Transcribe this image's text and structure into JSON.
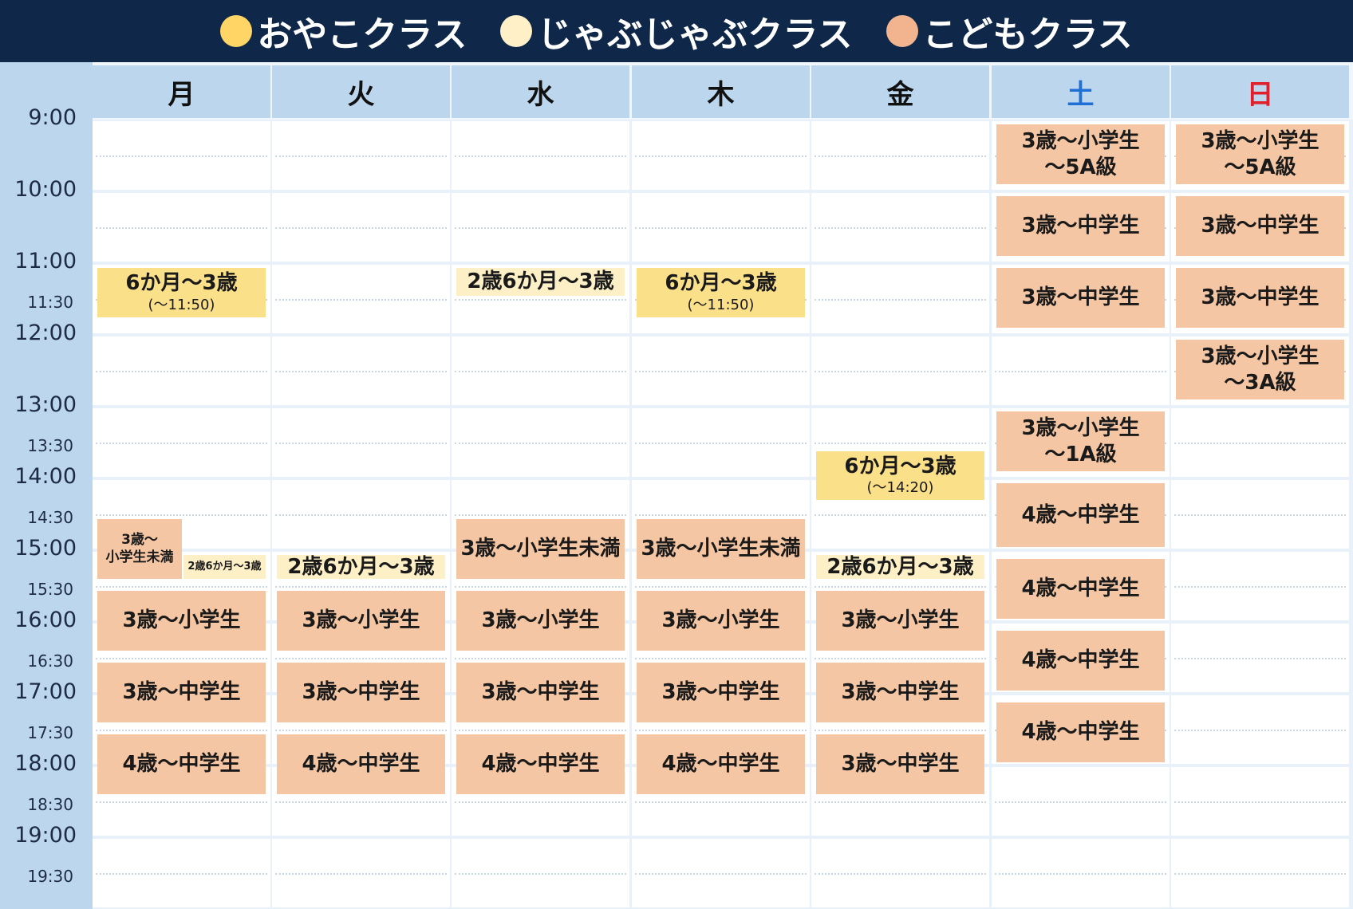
{
  "legend": [
    {
      "label": "おやこクラス",
      "color": "#ffd666"
    },
    {
      "label": "じゃぶじゃぶクラス",
      "color": "#fff0c7"
    },
    {
      "label": "こどもクラス",
      "color": "#f2b48f"
    }
  ],
  "days": [
    {
      "label": "月",
      "color": "#111111"
    },
    {
      "label": "火",
      "color": "#111111"
    },
    {
      "label": "水",
      "color": "#111111"
    },
    {
      "label": "木",
      "color": "#111111"
    },
    {
      "label": "金",
      "color": "#111111"
    },
    {
      "label": "土",
      "color": "#1f6fd6"
    },
    {
      "label": "日",
      "color": "#e0202a"
    }
  ],
  "times": [
    "9:00",
    "10:00",
    "11:00",
    "11:30",
    "12:00",
    "13:00",
    "13:30",
    "14:00",
    "14:30",
    "15:00",
    "15:30",
    "16:00",
    "16:30",
    "17:00",
    "17:30",
    "18:00",
    "18:30",
    "19:00",
    "19:30"
  ],
  "class_colors": {
    "kodomo": "#f5c6a3",
    "oyako": "#fbe08a",
    "jabu": "#fdefc6"
  },
  "events": [
    {
      "day": 0,
      "start": 11.0,
      "end": 11.75,
      "type": "oyako",
      "text": "6か月～3歳",
      "sub": "(～11:50)"
    },
    {
      "day": 0,
      "start": 14.5,
      "end": 15.4,
      "type": "kodomo",
      "text": "3歳～\n小学生未満",
      "part": "left",
      "small": true
    },
    {
      "day": 0,
      "start": 15.0,
      "end": 15.4,
      "type": "jabu",
      "text": "2歳6か月～3歳",
      "part": "right",
      "tiny": true
    },
    {
      "day": 0,
      "start": 15.5,
      "end": 16.4,
      "type": "kodomo",
      "text": "3歳～小学生"
    },
    {
      "day": 0,
      "start": 16.5,
      "end": 17.4,
      "type": "kodomo",
      "text": "3歳～中学生"
    },
    {
      "day": 0,
      "start": 17.5,
      "end": 18.4,
      "type": "kodomo",
      "text": "4歳～中学生"
    },
    {
      "day": 1,
      "start": 15.0,
      "end": 15.4,
      "type": "jabu",
      "text": "2歳6か月～3歳"
    },
    {
      "day": 1,
      "start": 15.5,
      "end": 16.4,
      "type": "kodomo",
      "text": "3歳～小学生"
    },
    {
      "day": 1,
      "start": 16.5,
      "end": 17.4,
      "type": "kodomo",
      "text": "3歳～中学生"
    },
    {
      "day": 1,
      "start": 17.5,
      "end": 18.4,
      "type": "kodomo",
      "text": "4歳～中学生"
    },
    {
      "day": 2,
      "start": 11.0,
      "end": 11.45,
      "type": "jabu",
      "text": "2歳6か月～3歳"
    },
    {
      "day": 2,
      "start": 14.5,
      "end": 15.4,
      "type": "kodomo",
      "text": "3歳～小学生未満"
    },
    {
      "day": 2,
      "start": 15.5,
      "end": 16.4,
      "type": "kodomo",
      "text": "3歳～小学生"
    },
    {
      "day": 2,
      "start": 16.5,
      "end": 17.4,
      "type": "kodomo",
      "text": "3歳～中学生"
    },
    {
      "day": 2,
      "start": 17.5,
      "end": 18.4,
      "type": "kodomo",
      "text": "4歳～中学生"
    },
    {
      "day": 3,
      "start": 11.0,
      "end": 11.75,
      "type": "oyako",
      "text": "6か月～3歳",
      "sub": "(～11:50)"
    },
    {
      "day": 3,
      "start": 14.5,
      "end": 15.4,
      "type": "kodomo",
      "text": "3歳～小学生未満"
    },
    {
      "day": 3,
      "start": 15.5,
      "end": 16.4,
      "type": "kodomo",
      "text": "3歳～小学生"
    },
    {
      "day": 3,
      "start": 16.5,
      "end": 17.4,
      "type": "kodomo",
      "text": "3歳～中学生"
    },
    {
      "day": 3,
      "start": 17.5,
      "end": 18.4,
      "type": "kodomo",
      "text": "4歳～中学生"
    },
    {
      "day": 4,
      "start": 13.55,
      "end": 14.3,
      "type": "oyako",
      "text": "6か月～3歳",
      "sub": "(～14:20)"
    },
    {
      "day": 4,
      "start": 15.0,
      "end": 15.4,
      "type": "jabu",
      "text": "2歳6か月～3歳"
    },
    {
      "day": 4,
      "start": 15.5,
      "end": 16.4,
      "type": "kodomo",
      "text": "3歳～小学生"
    },
    {
      "day": 4,
      "start": 16.5,
      "end": 17.4,
      "type": "kodomo",
      "text": "3歳～中学生"
    },
    {
      "day": 4,
      "start": 17.5,
      "end": 18.4,
      "type": "kodomo",
      "text": "3歳～中学生"
    },
    {
      "day": 5,
      "start": 9.0,
      "end": 9.9,
      "type": "kodomo",
      "text": "3歳～小学生\n～5A級"
    },
    {
      "day": 5,
      "start": 10.0,
      "end": 10.9,
      "type": "kodomo",
      "text": "3歳～中学生"
    },
    {
      "day": 5,
      "start": 11.0,
      "end": 11.9,
      "type": "kodomo",
      "text": "3歳～中学生"
    },
    {
      "day": 5,
      "start": 13.0,
      "end": 13.9,
      "type": "kodomo",
      "text": "3歳～小学生\n～1A級"
    },
    {
      "day": 5,
      "start": 14.0,
      "end": 14.95,
      "type": "kodomo",
      "text": "4歳～中学生"
    },
    {
      "day": 5,
      "start": 15.05,
      "end": 15.95,
      "type": "kodomo",
      "text": "4歳～中学生"
    },
    {
      "day": 5,
      "start": 16.05,
      "end": 16.95,
      "type": "kodomo",
      "text": "4歳～中学生"
    },
    {
      "day": 5,
      "start": 17.05,
      "end": 17.95,
      "type": "kodomo",
      "text": "4歳～中学生"
    },
    {
      "day": 6,
      "start": 9.0,
      "end": 9.9,
      "type": "kodomo",
      "text": "3歳～小学生\n～5A級"
    },
    {
      "day": 6,
      "start": 10.0,
      "end": 10.9,
      "type": "kodomo",
      "text": "3歳～中学生"
    },
    {
      "day": 6,
      "start": 11.0,
      "end": 11.9,
      "type": "kodomo",
      "text": "3歳～中学生"
    },
    {
      "day": 6,
      "start": 12.0,
      "end": 12.9,
      "type": "kodomo",
      "text": "3歳～小学生\n～3A級"
    }
  ]
}
